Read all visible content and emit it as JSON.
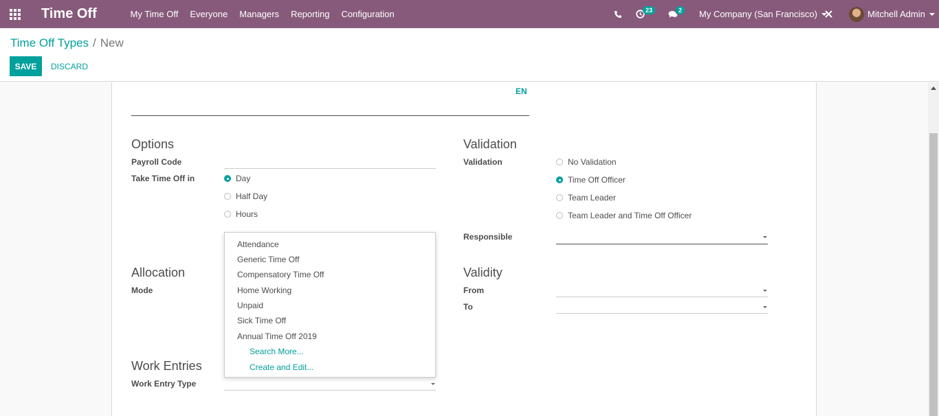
{
  "navbar": {
    "app_title": "Time Off",
    "menu": [
      "My Time Off",
      "Everyone",
      "Managers",
      "Reporting",
      "Configuration"
    ],
    "activity_count": "23",
    "messages_count": "2",
    "company": "My Company (San Francisco)",
    "user": "Mitchell Admin",
    "colors": {
      "navbar": "#875a7b",
      "accent": "#00a09d"
    }
  },
  "breadcrumb": {
    "parent": "Time Off Types",
    "separator": "/",
    "current": "New"
  },
  "buttons": {
    "save": "SAVE",
    "discard": "DISCARD"
  },
  "form": {
    "lang": "EN",
    "options": {
      "title": "Options",
      "payroll_code_label": "Payroll Code",
      "take_time_off_label": "Take Time Off in",
      "take_time_off_options": [
        "Day",
        "Half Day",
        "Hours"
      ],
      "take_time_off_selected": "Day"
    },
    "validation": {
      "title": "Validation",
      "validation_label": "Validation",
      "validation_options": [
        "No Validation",
        "Time Off Officer",
        "Team Leader",
        "Team Leader and Time Off Officer"
      ],
      "validation_selected": "Time Off Officer",
      "responsible_label": "Responsible"
    },
    "allocation": {
      "title": "Allocation",
      "mode_label": "Mode"
    },
    "validity": {
      "title": "Validity",
      "from_label": "From",
      "to_label": "To"
    },
    "work_entries": {
      "title": "Work Entries",
      "work_entry_type_label": "Work Entry Type"
    }
  },
  "dropdown": {
    "items": [
      "Attendance",
      "Generic Time Off",
      "Compensatory Time Off",
      "Home Working",
      "Unpaid",
      "Sick Time Off",
      "Annual Time Off 2019"
    ],
    "search_more": "Search More...",
    "create_and_edit": "Create and Edit..."
  }
}
